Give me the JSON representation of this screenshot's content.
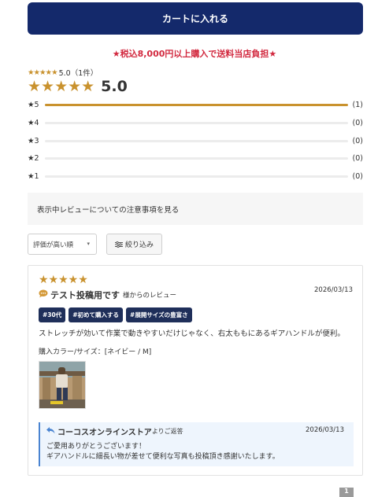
{
  "cart_button": "カートに入れる",
  "promo": "★税込8,000円以上購入で送料当店負担★",
  "summary": {
    "stars": "★★★★★",
    "average_small": "5.0（1件）",
    "average": "5.0",
    "rating_value": 5.0,
    "count": 1
  },
  "distribution": [
    {
      "label": "★5",
      "count": "(1)",
      "fraction": 1.0
    },
    {
      "label": "★4",
      "count": "(0)",
      "fraction": 0
    },
    {
      "label": "★3",
      "count": "(0)",
      "fraction": 0
    },
    {
      "label": "★2",
      "count": "(0)",
      "fraction": 0
    },
    {
      "label": "★1",
      "count": "(0)",
      "fraction": 0
    }
  ],
  "notice_link": "表示中レビューについての注意事項を見る",
  "sort": {
    "selected": "評価が高い順"
  },
  "filter_button": "絞り込み",
  "review": {
    "stars": "★★★★★",
    "title": "テスト投稿用です",
    "title_suffix": "様からのレビュー",
    "date": "2026/03/13",
    "tags": [
      "#30代",
      "#初めて購入する",
      "#展開サイズの豊富さ"
    ],
    "body": "ストレッチが効いて作業で動きやすいだけじゃなく、右太ももにあるギアハンドルが便利。",
    "purchase": "購入カラー/サイズ：[ネイビー / M]"
  },
  "reply": {
    "shop": "コーコスオンラインストア",
    "shop_suffix": "よりご返答",
    "date": "2026/03/13",
    "line1": "ご愛用ありがとうございます！",
    "line2": "ギアハンドルに細長い物が差せて便利な写真も投稿頂き感謝いたします。"
  },
  "pagination": {
    "current": "1"
  },
  "colors": {
    "navy": "#14296b",
    "gold": "#c9922e",
    "promo_red": "#d2293f",
    "reply_blue": "#4a84d1"
  }
}
